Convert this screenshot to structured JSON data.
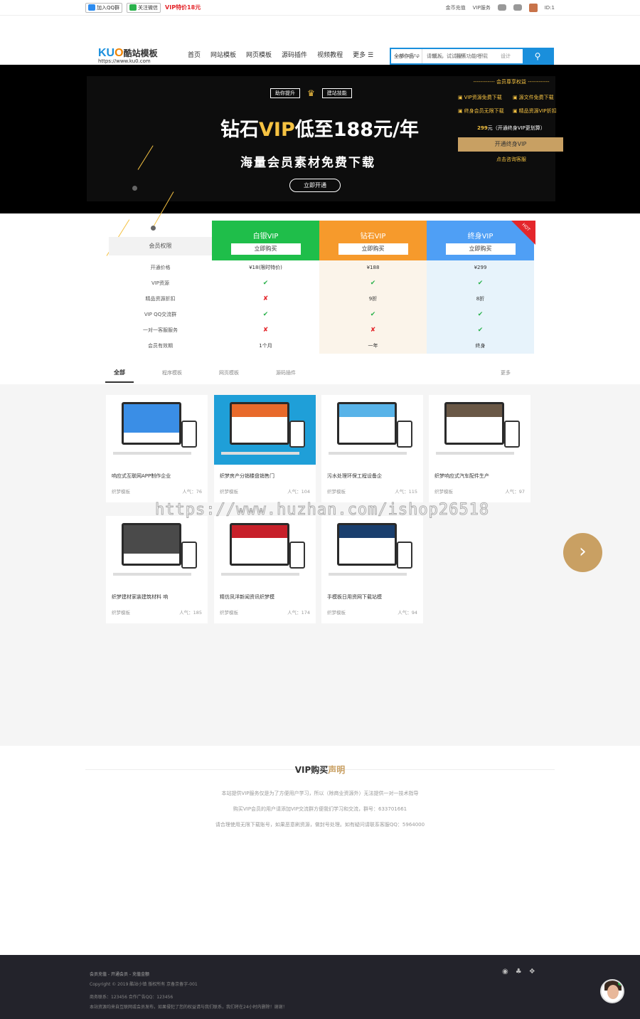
{
  "topbar": {
    "qq_group": "加入QQ群",
    "wechat": "关注微信",
    "vip_promo": "VIP特价18元",
    "recharge": "金币充值",
    "vip_service": "VIP服务",
    "user_id": "ID:1"
  },
  "header": {
    "logo_text": "KU",
    "logo_o": "O",
    "logo_cn": "酷站模板",
    "logo_url": "https://www.ku0.com",
    "nav": [
      "首页",
      "网站模板",
      "网页模板",
      "源码插件",
      "视频教程",
      "更多 ☰"
    ],
    "search_select": "全部作品 ⌄",
    "search_placeholder": "请输入，试试搜索功能吧！",
    "hot_words": [
      "angelina",
      "模板",
      "素材",
      "下载",
      "设计"
    ]
  },
  "banner": {
    "tag1": "助你提升",
    "tag2": "建站技能",
    "headline_a": "钻石",
    "headline_vip": "VIP",
    "headline_b": "低至188元/年",
    "subline": "海量会员素材免费下载",
    "open_btn": "立即开通",
    "panel_title": "------------  会员尊享权益  ------------",
    "perks": [
      "VIP资源免费下载",
      "源文件免费下载",
      "终身会员无限下载",
      "精品资源VIP折扣"
    ],
    "price_val": "299",
    "price_text": "元（开通终身VIP更划算）",
    "lifetime_btn": "开通终身VIP",
    "consult": "点击咨询客服",
    "colors": {
      "gold": "#c8a063",
      "yellow": "#f5c242"
    }
  },
  "pricing": {
    "perm_header": "会员权限",
    "plans": [
      {
        "name": "白银VIP",
        "buy": "立即购买",
        "color": "#1fbe4a",
        "bg": "#ffffff"
      },
      {
        "name": "钻石VIP",
        "buy": "立即购买",
        "color": "#f69a2c",
        "bg": "#fbf4ea"
      },
      {
        "name": "终身VIP",
        "buy": "立即购买",
        "color": "#4f9ff5",
        "bg": "#e7f3fb"
      }
    ],
    "hot_badge": "HOT",
    "rows": [
      {
        "label": "开通价格",
        "values": [
          "¥18(限时特价)",
          "¥188",
          "¥299"
        ]
      },
      {
        "label": "VIP资源",
        "values": [
          "✔",
          "✔",
          "✔"
        ]
      },
      {
        "label": "精品资源折扣",
        "values": [
          "✘",
          "9折",
          "8折"
        ]
      },
      {
        "label": "VIP QQ交流群",
        "values": [
          "✔",
          "✔",
          "✔"
        ]
      },
      {
        "label": "一对一客服服务",
        "values": [
          "✘",
          "✘",
          "✔"
        ]
      },
      {
        "label": "会员有效期",
        "values": [
          "1个月",
          "一年",
          "终身"
        ]
      }
    ]
  },
  "tabs": {
    "items": [
      "全部",
      "程序模板",
      "网页模板",
      "源码插件"
    ],
    "more": "更多"
  },
  "cards": [
    {
      "title": "响应式互联网APP制作企业",
      "cat": "织梦模板",
      "pop": "人气：76",
      "theme": "#ffffff",
      "accent": "#3a8ee6"
    },
    {
      "title": "织梦房产分销楼盘销售门",
      "cat": "织梦模板",
      "pop": "人气：104",
      "theme": "#1f9fd8",
      "accent": "#e86a2b"
    },
    {
      "title": "污水处理环保工程设备企",
      "cat": "织梦模板",
      "pop": "人气：115",
      "theme": "#ffffff",
      "accent": "#58b3e8"
    },
    {
      "title": "织梦响应式汽车配件生产",
      "cat": "织梦模板",
      "pop": "人气：97",
      "theme": "#ffffff",
      "accent": "#6a5846"
    },
    {
      "title": "织梦建材家装建筑材料 响",
      "cat": "织梦模板",
      "pop": "人气：185",
      "theme": "#ffffff",
      "accent": "#4a4a4a"
    },
    {
      "title": "精仿凤洋新闻资讯织梦模",
      "cat": "织梦模板",
      "pop": "人气：174",
      "theme": "#ffffff",
      "accent": "#c7202a"
    },
    {
      "title": "手模板日用资网下载站模",
      "cat": "织梦模板",
      "pop": "人气：94",
      "theme": "#ffffff",
      "accent": "#1a3f6e"
    }
  ],
  "watermark": "https://www.huzhan.com/ishop26518",
  "declaration": {
    "title_a": "VIP购买",
    "title_b": "声明",
    "lines": [
      "本站提供VIP服务仅是为了方便用户学习，所以（除商业资源外）无法提供一对一技术指导",
      "购买VIP会员的用户请添加VIP交流群方便我们学习和交流，群号：633701661",
      "请合理使用无限下载账号，如果恶意刷资源，做封号处理。如有疑问请联系客服QQ：5964000"
    ]
  },
  "footer": {
    "links": "会员充值  -  开通会员  -  充值金额",
    "copyright": "Copyright © 2019 酷站小镇 版权所有  京备京备字-001",
    "contact": "商务联系：123456  合作广告QQ：123456",
    "notice": "本站资源均来自互联网或会员发布，如果侵犯了您的权益请与我们联系，我们将在24小时内删除！谢谢！"
  }
}
